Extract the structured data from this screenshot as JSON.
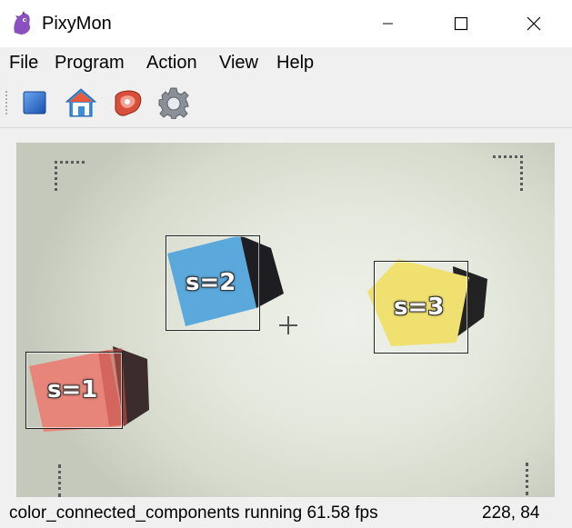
{
  "window": {
    "title": "PixyMon",
    "controls": [
      "minimize",
      "maximize",
      "close"
    ]
  },
  "menu": {
    "items": [
      "File",
      "Program",
      "Action",
      "View",
      "Help"
    ]
  },
  "toolbar": {
    "buttons": [
      {
        "name": "stop-icon",
        "color": "#2f6fd0"
      },
      {
        "name": "home-icon",
        "color": "#3a8fd8"
      },
      {
        "name": "raw-frame-icon",
        "color": "#d8503a"
      },
      {
        "name": "gear-icon",
        "color": "#8a8f98"
      }
    ]
  },
  "camera": {
    "blobs": [
      {
        "label": "s=1",
        "color": "#e8857a"
      },
      {
        "label": "s=2",
        "color": "#5aa8dc"
      },
      {
        "label": "s=3",
        "color": "#f0e070"
      }
    ]
  },
  "status": {
    "text": "color_connected_components running 61.58 fps",
    "coords": "228, 84"
  }
}
